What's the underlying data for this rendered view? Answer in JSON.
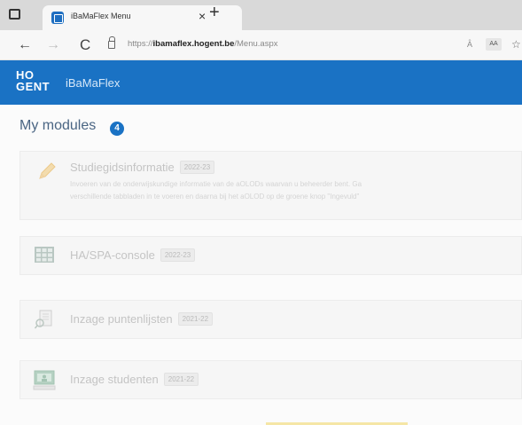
{
  "browser": {
    "tab_title": "iBaMaFlex Menu",
    "tab_close": "×",
    "new_tab": "+",
    "address_prefix": "https://",
    "address_host": "ibamaflex.hogent.be",
    "address_path": "/Menu.aspx",
    "read_aloud": "Ȃ",
    "reader_label": "AA",
    "nav_back": "←",
    "nav_forward": "→",
    "nav_reload": "C",
    "favorite": "☆"
  },
  "app": {
    "logo_line1": "HO",
    "logo_line2": "GENT",
    "name": "iBaMaFlex",
    "brand_color": "#1a72c4"
  },
  "page": {
    "title": "My modules",
    "module_count": "4"
  },
  "modules": [
    {
      "name": "Studiegidsinformatie",
      "year": "2022-23",
      "icon": "pencil-icon",
      "description_line1": "Invoeren van de onderwijskundige informatie van de aOLODs waarvan u beheerder bent. Ga",
      "description_line2": "verschillende tabbladen in te voeren en daarna bij het aOLOD op de groene knop \"Ingevuld\""
    },
    {
      "name": "HA/SPA-console",
      "year": "2022-23",
      "icon": "grid-icon"
    },
    {
      "name": "Inzage puntenlijsten",
      "year": "2021-22",
      "icon": "doc-search-icon"
    },
    {
      "name": "Inzage studenten",
      "year": "2021-22",
      "icon": "screen-icon"
    }
  ]
}
